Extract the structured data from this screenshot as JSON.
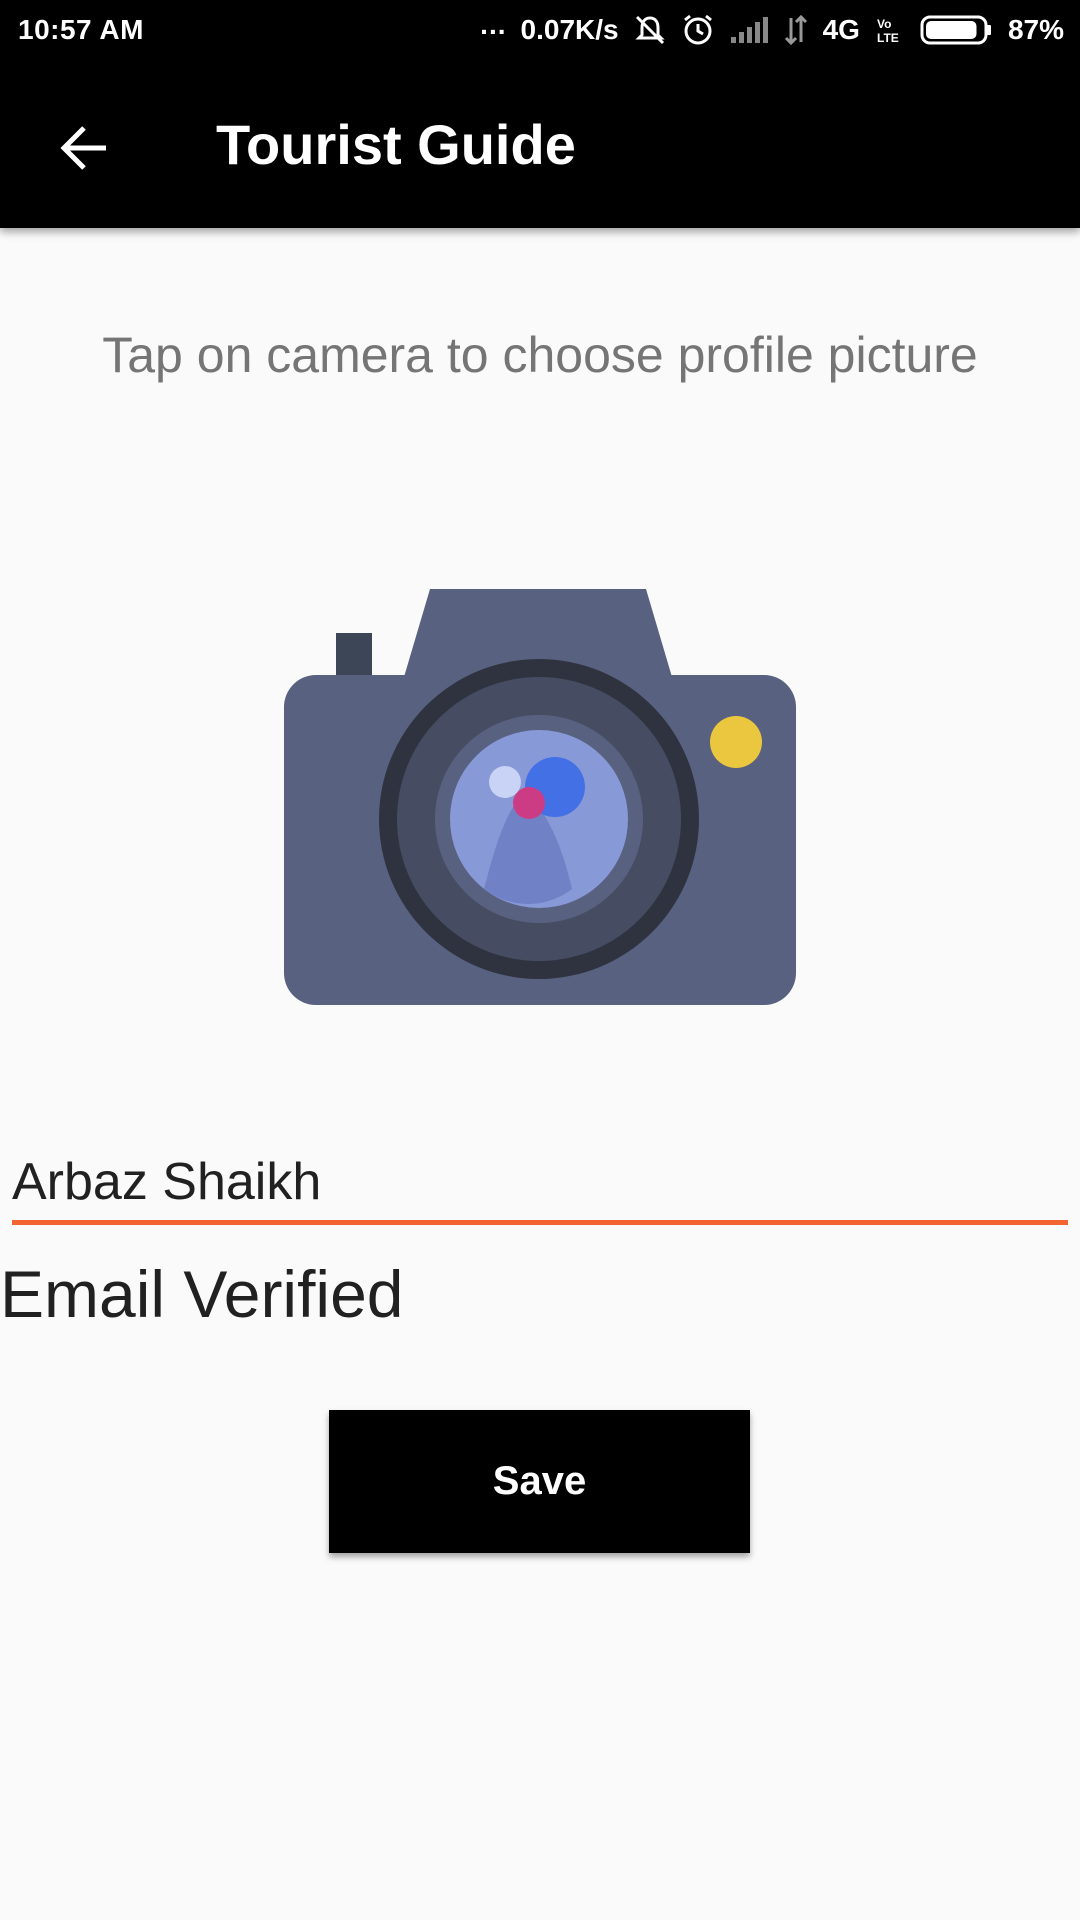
{
  "status_bar": {
    "time": "10:57 AM",
    "more_dots": "...",
    "speed": "0.07K/s",
    "network": "4G",
    "volte": "VoLTE",
    "battery_percent": "87%",
    "battery_level": 0.87,
    "icons": [
      "mute-icon",
      "alarm-icon",
      "signal-icon",
      "data-arrows-icon",
      "volte-icon",
      "battery-icon"
    ]
  },
  "app_bar": {
    "title": "Tourist Guide",
    "back_icon": "arrow-back-icon"
  },
  "profile": {
    "instruction": "Tap on camera to choose profile picture",
    "camera_icon": "camera-icon"
  },
  "form": {
    "name_value": "Arbaz Shaikh",
    "email_status": "Email Verified",
    "save_label": "Save"
  },
  "colors": {
    "app_bar": "#000000",
    "background": "#fafafa",
    "input_underline": "#f26430",
    "button_background": "#000000",
    "button_text": "#ffffff",
    "camera_body": "#58617f",
    "camera_flash": "#ebc73f",
    "camera_lens": "#8899d8"
  }
}
